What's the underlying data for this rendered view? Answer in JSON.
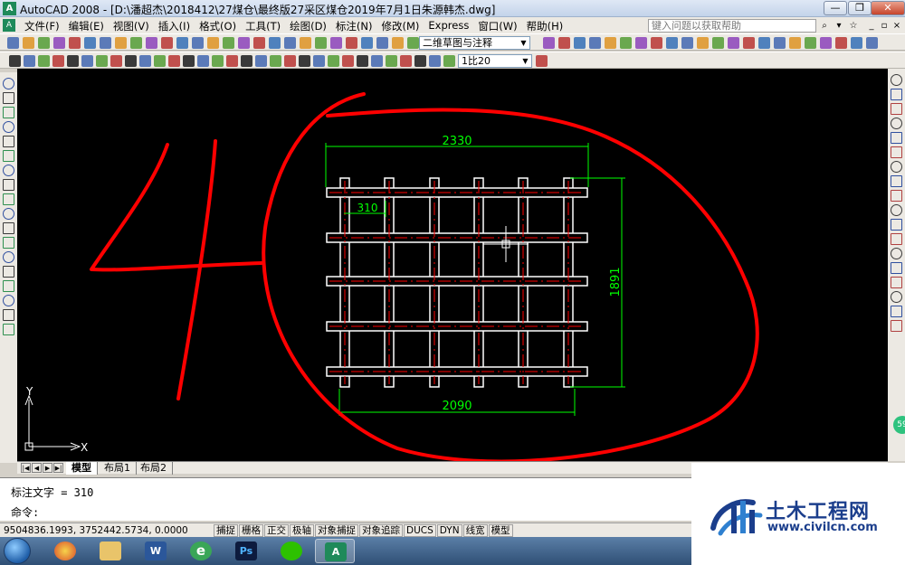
{
  "window": {
    "app_icon": "A",
    "title": "AutoCAD 2008 - [D:\\潘超杰\\2018412\\27煤仓\\最终版27采区煤仓2019年7月1日朱源韩杰.dwg]",
    "btn_minimize": "—",
    "btn_restore": "❐",
    "btn_close": "✕"
  },
  "menu": {
    "items": [
      "文件(F)",
      "编辑(E)",
      "视图(V)",
      "插入(I)",
      "格式(O)",
      "工具(T)",
      "绘图(D)",
      "标注(N)",
      "修改(M)",
      "Express",
      "窗口(W)",
      "帮助(H)"
    ],
    "help_placeholder": "键入问题以获取帮助",
    "doc_min": "_",
    "doc_restore": "▫",
    "doc_close": "×"
  },
  "toolbar": {
    "workspace": "二维草图与注释",
    "scale": "1比20"
  },
  "drawing": {
    "dim_top": "2330",
    "dim_bottom": "2090",
    "dim_right": "1891",
    "dim_spacing": "310",
    "handwritten_number": "4",
    "ucs_y": "Y",
    "ucs_x": "X",
    "badge": "59"
  },
  "tabs": {
    "items": [
      "模型",
      "布局1",
      "布局2"
    ],
    "active": "模型"
  },
  "command": {
    "history": "标注文字 = 310",
    "prompt": "命令:"
  },
  "status": {
    "coords": "9504836.1993, 3752442.5734, 0.0000",
    "buttons": [
      "捕捉",
      "栅格",
      "正交",
      "极轴",
      "对象捕捉",
      "对象追踪",
      "DUCS",
      "DYN",
      "线宽",
      "模型"
    ]
  },
  "taskbar": {
    "apps": [
      "explorer-icon",
      "word-icon",
      "ie-icon",
      "photoshop-icon",
      "wechat-icon",
      "autocad-icon"
    ],
    "word_glyph": "W",
    "ie_glyph": "e",
    "ps_glyph": "Ps",
    "acad_glyph": "A"
  },
  "watermark": {
    "title": "土木工程网",
    "url": "www.civilcn.com"
  },
  "colors": {
    "canvas": "#000000",
    "dimension": "#00ff00",
    "annotation": "#ff0000",
    "steel": "#ffffff",
    "center_line": "#ff0000"
  }
}
